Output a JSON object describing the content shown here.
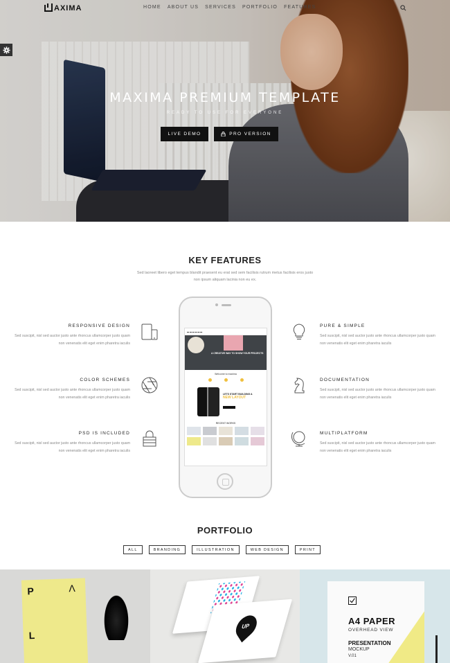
{
  "header": {
    "logo_text": "AXIMA",
    "nav": [
      "HOME",
      "ABOUT US",
      "SERVICES",
      "PORTFOLIO",
      "FEATURES"
    ],
    "search_icon": "search-icon",
    "settings_icon": "gear-icon"
  },
  "hero": {
    "title": "MAXIMA PREMIUM TEMPLATE",
    "subtitle": "READY TO USE FOR EVERYONE",
    "live_demo": "LIVE DEMO",
    "pro_version": "PRO VERSION",
    "pro_icon": "lock-icon"
  },
  "features": {
    "title": "KEY FEATURES",
    "description": "Sed laoreet libero eget tempus blandit praesent eu erat sed sem facilisis rutrum metus facilisis eros justo non ipsum aliquam lacinia non eu ex.",
    "left": [
      {
        "title": "RESPONSIVE DESIGN",
        "text": "Sed suscipit, nisl sed auctor justo ante rhoncus ullamcorper justo quam non venenatis elit eget enim pharetra iaculis",
        "icon": "devices-icon"
      },
      {
        "title": "COLOR SCHEMES",
        "text": "Sed suscipit, nisl sed auctor justo ante rhoncus ullamcorper justo quam non venenatis elit eget enim pharetra iaculis",
        "icon": "aperture-icon"
      },
      {
        "title": "PSD IS INCLUDED",
        "text": "Sed suscipit, nisl sed auctor justo ante rhoncus ullamcorper justo quam non venenatis elit eget enim pharetra iaculis",
        "icon": "padlock-icon"
      }
    ],
    "right": [
      {
        "title": "PURE & SIMPLE",
        "text": "Sed suscipit, nisl sed auctor justo ante rhoncus ullamcorper justo quam non venenatis elit eget enim pharetra iaculis",
        "icon": "lightbulb-icon"
      },
      {
        "title": "DOCUMENTATION",
        "text": "Sed suscipit, nisl sed auctor justo ante rhoncus ullamcorper justo quam non venenatis elit eget enim pharetra iaculis",
        "icon": "chess-knight-icon"
      },
      {
        "title": "MULTIPLATFORM",
        "text": "Sed suscipit, nisl sed auctor justo ante rhoncus ullamcorper justo quam non venenatis elit eget enim pharetra iaculis",
        "icon": "globe-icon"
      }
    ],
    "phone_screen": {
      "hero_text": "A CREATIVE WAY TO SHOW YOUR PROJECTS",
      "welcome": "Welcome to maxima",
      "lets_start": "LETS START BUILDING A",
      "new_layout": "NEW LAYOUT",
      "recent_works": "RECENT WORKS"
    }
  },
  "portfolio": {
    "title": "PORTFOLIO",
    "filters": [
      "ALL",
      "BRANDING",
      "ILLUSTRATION",
      "WEB DESIGN",
      "PRINT"
    ],
    "paper_letters": [
      "P",
      "Λ",
      "L"
    ],
    "card_logo": "UP",
    "a4": {
      "heading": "A4 PAPER",
      "sub": "OVERHEAD VIEW",
      "presentation": "PRESENTATION",
      "mockup": "MOCKUP",
      "version": "V.01"
    }
  },
  "colors": {
    "accent_dark": "#111111",
    "paper_yellow": "#eee98b"
  }
}
